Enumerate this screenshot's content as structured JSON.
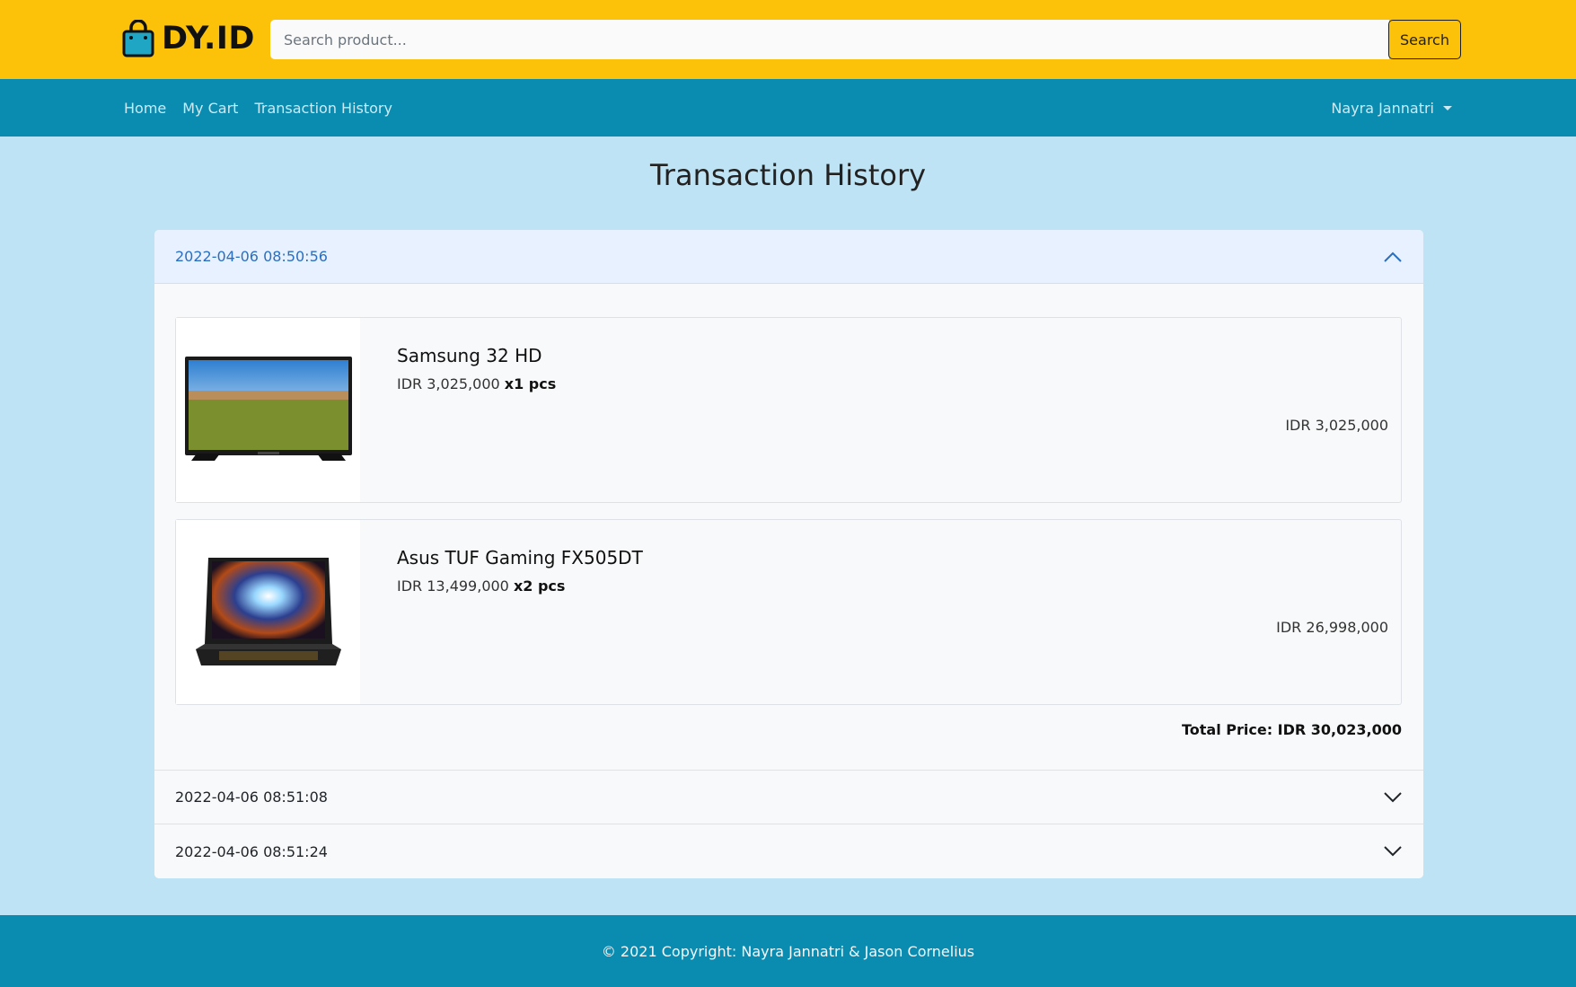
{
  "brand": {
    "name": "DY.ID",
    "color": "#fcc20a"
  },
  "search": {
    "placeholder": "Search product...",
    "button_label": "Search"
  },
  "nav": {
    "links": [
      "Home",
      "My Cart",
      "Transaction History"
    ],
    "user_name": "Nayra Jannatri"
  },
  "page": {
    "title": "Transaction History"
  },
  "transactions": [
    {
      "timestamp": "2022-04-06 08:50:56",
      "expanded": true,
      "items": [
        {
          "name": "Samsung 32 HD",
          "unit_price": "IDR 3,025,000",
          "qty": "x1 pcs",
          "subtotal": "IDR 3,025,000",
          "image_icon": "tv-image"
        },
        {
          "name": "Asus TUF Gaming FX505DT",
          "unit_price": "IDR 13,499,000",
          "qty": "x2 pcs",
          "subtotal": "IDR 26,998,000",
          "image_icon": "laptop-image"
        }
      ],
      "total": "Total Price: IDR 30,023,000"
    },
    {
      "timestamp": "2022-04-06 08:51:08",
      "expanded": false
    },
    {
      "timestamp": "2022-04-06 08:51:24",
      "expanded": false
    }
  ],
  "footer": {
    "text": "© 2021 Copyright: Nayra Jannatri & Jason Cornelius"
  },
  "colors": {
    "header": "#fcc20a",
    "nav": "#0a8bb0",
    "background": "#bde3f4",
    "accent": "#2a6fbf"
  }
}
